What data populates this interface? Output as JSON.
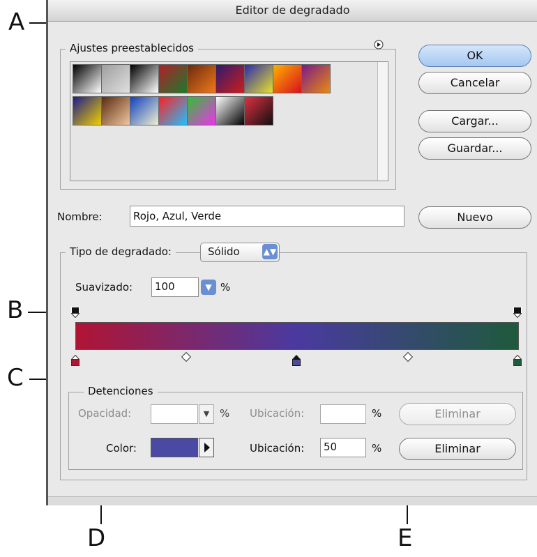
{
  "window": {
    "title": "Editor de degradado"
  },
  "presets": {
    "legend": "Ajustes preestablecidos",
    "menu_icon": "circle-arrow-icon",
    "swatches": [
      [
        "#000000",
        "#ffffff"
      ],
      [
        "#9e9e9e",
        "#e0e0e0"
      ],
      [
        "#000000",
        "#ffffff"
      ],
      [
        "#b0202a",
        "#1c7a2c"
      ],
      [
        "#6b2a0f",
        "#f07a1a"
      ],
      [
        "#2c1b6d",
        "#d01c1c"
      ],
      [
        "#2a2ab0",
        "#e8e028"
      ],
      [
        "#ffb000",
        "#d8101e"
      ],
      [
        "#7a1a8a",
        "#e88a10"
      ],
      [
        "#1c1c8a",
        "#f0d000"
      ],
      [
        "#5a2a10",
        "#f0c8a0"
      ],
      [
        "#1040c0",
        "#f0f0d0"
      ],
      [
        "#ff2020",
        "#20c0ff"
      ],
      [
        "#30c030",
        "#f030f0"
      ],
      [
        "#ffffff",
        "#000000"
      ],
      [
        "#e03040",
        "#101010"
      ]
    ]
  },
  "buttons": {
    "ok": "OK",
    "cancel": "Cancelar",
    "load": "Cargar...",
    "save": "Guardar...",
    "new": "Nuevo"
  },
  "name": {
    "label": "Nombre:",
    "value": "Rojo, Azul, Verde"
  },
  "gradient_type": {
    "legend": "Tipo de degradado:",
    "selected": "Sólido",
    "smoothness_label": "Suavizado:",
    "smoothness_value": "100",
    "percent": "%"
  },
  "gradient": {
    "colors": [
      "#b01434",
      "#4a3aa0",
      "#1e5a3c"
    ]
  },
  "stops": {
    "legend": "Detenciones",
    "opacity_label": "Opacidad:",
    "opacity_value": "",
    "opacity_location_label": "Ubicación:",
    "opacity_location_value": "",
    "color_label": "Color:",
    "color_value": "#4a4aa4",
    "color_location_label": "Ubicación:",
    "color_location_value": "50",
    "percent": "%",
    "delete_label": "Eliminar"
  },
  "callouts": {
    "a": "A",
    "b": "B",
    "c": "C",
    "d": "D",
    "e": "E"
  }
}
